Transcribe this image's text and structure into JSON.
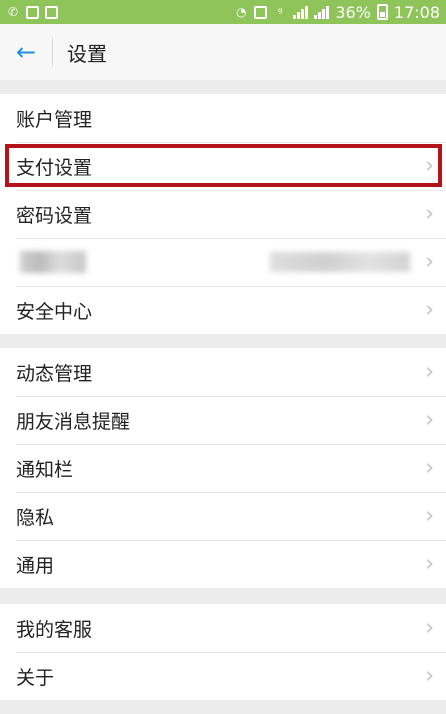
{
  "statusbar": {
    "battery": "36%",
    "time": "17:08"
  },
  "header": {
    "back_icon": "←",
    "title": "设置"
  },
  "group1": [
    {
      "label": "账户管理"
    },
    {
      "label": "支付设置"
    },
    {
      "label": "密码设置"
    },
    {
      "label": ""
    },
    {
      "label": "安全中心"
    }
  ],
  "group2": [
    {
      "label": "动态管理"
    },
    {
      "label": "朋友消息提醒"
    },
    {
      "label": "通知栏"
    },
    {
      "label": "隐私"
    },
    {
      "label": "通用"
    }
  ],
  "group3": [
    {
      "label": "我的客服"
    },
    {
      "label": "关于"
    }
  ],
  "chevron": "›",
  "highlight_color": "#b3141a",
  "accent_color": "#1f8fe0"
}
